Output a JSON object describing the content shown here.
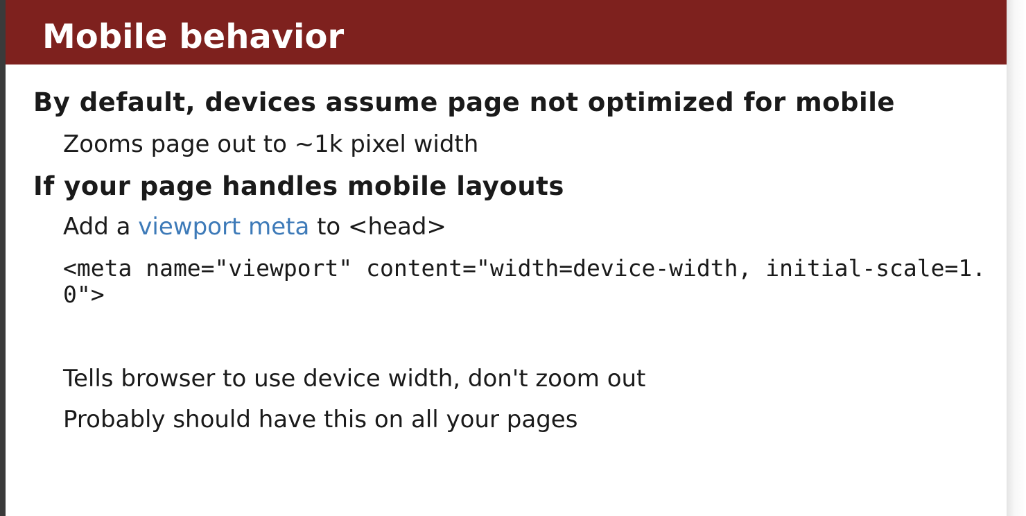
{
  "slide": {
    "title": "Mobile behavior",
    "bullet1": "By default, devices assume page not optimized for mobile",
    "bullet1_sub1": "Zooms page out to ~1k pixel width",
    "bullet2": "If your page handles mobile layouts",
    "bullet2_sub1": {
      "prefix": "Add a ",
      "link": "viewport meta",
      "suffix": " to <head>"
    },
    "code": "<meta name=\"viewport\" content=\"width=device-width, initial-scale=1.0\">",
    "bullet2_sub2": "Tells browser to use device width, don't zoom out",
    "bullet2_sub3": "Probably should have this on all your pages"
  },
  "colors": {
    "title_bar": "#7e211e",
    "title_text": "#ffffff",
    "body_text": "#1a1a1a",
    "link": "#3d7ab8"
  }
}
